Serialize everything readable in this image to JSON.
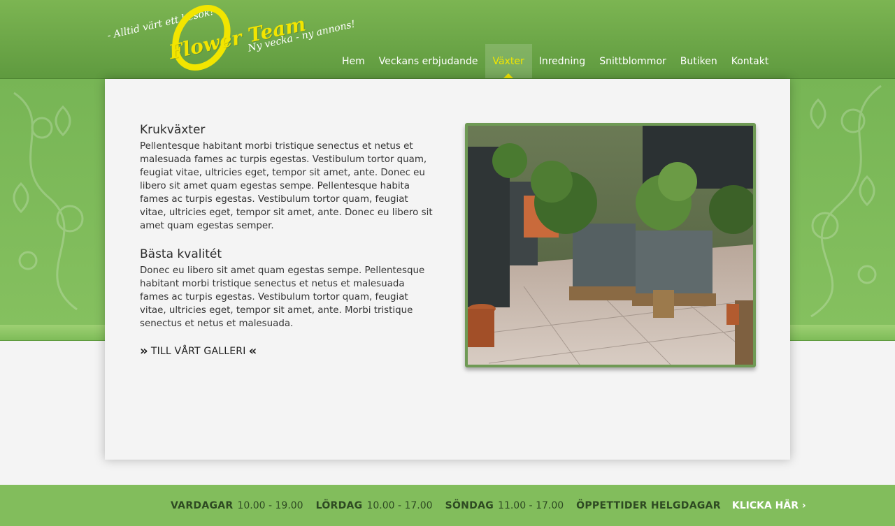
{
  "logo": {
    "tagline_left": "- Alltid värt ett besök!",
    "brand": "Flower Team",
    "tagline_right": "Ny vecka - ny annons!",
    "brand_color": "#f2e500"
  },
  "nav": {
    "items": [
      {
        "label": "Hem"
      },
      {
        "label": "Veckans erbjudande"
      },
      {
        "label": "Växter",
        "active": true
      },
      {
        "label": "Inredning"
      },
      {
        "label": "Snittblommor"
      },
      {
        "label": "Butiken"
      },
      {
        "label": "Kontakt"
      }
    ]
  },
  "content": {
    "section1_title": "Krukväxter",
    "section1_text": "Pellentesque habitant morbi tristique senectus et netus et malesuada fames ac turpis egestas. Vestibulum tortor quam, feugiat vitae, ultricies eget, tempor sit amet, ante. Donec eu libero sit amet quam egestas sempe. Pellentesque habita fames ac turpis egestas. Vestibulum tortor quam, feugiat vitae, ultricies eget, tempor sit amet, ante. Donec eu libero sit amet quam egestas semper.",
    "section2_title": "Bästa kvalitét",
    "section2_text": "Donec eu libero sit amet quam egestas sempe. Pellentesque habitant morbi tristique senectus et netus et malesuada fames ac turpis egestas. Vestibulum tortor quam, feugiat vitae, ultricies eget, tempor sit amet, ante. Morbi tristique senectus et netus et malesuada.",
    "gallery_left": "»",
    "gallery_link": "TILL VÅRT GALLERI",
    "gallery_right": "«"
  },
  "footer": {
    "weekday_label": "VARDAGAR",
    "weekday_hours": "10.00 - 19.00",
    "saturday_label": "LÖRDAG",
    "saturday_hours": "10.00 - 17.00",
    "sunday_label": "SÖNDAG",
    "sunday_hours": "11.00 - 17.00",
    "holiday_label": "ÖPPETTIDER HELGDAGAR",
    "cta": "KLICKA HÄR ›"
  },
  "colors": {
    "header_green": "#6aa747",
    "accent_yellow": "#f2e500",
    "footer_green": "#82bd5c"
  },
  "icons": [
    "double-chevron-right-icon",
    "double-chevron-left-icon",
    "chevron-right-icon"
  ]
}
